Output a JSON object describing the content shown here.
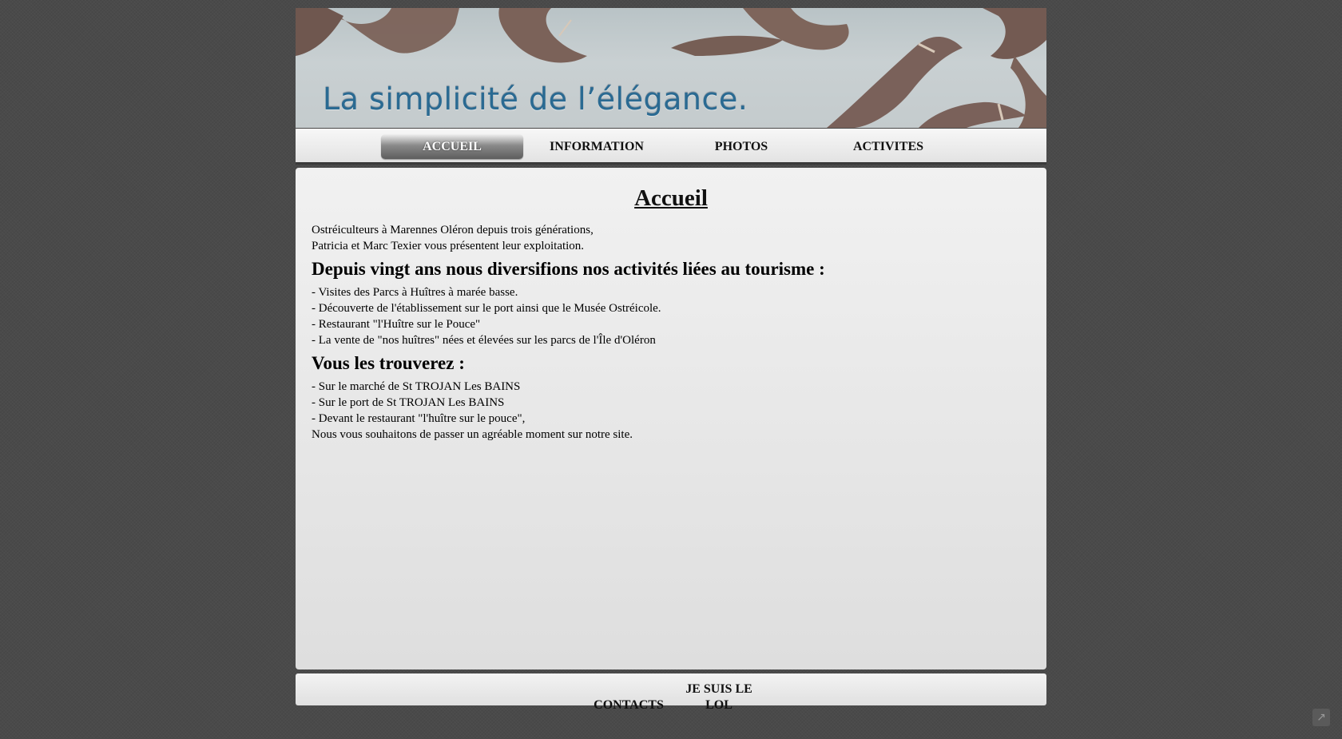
{
  "banner": {
    "slogan": "La simplicité de l’élégance."
  },
  "nav": {
    "items": [
      {
        "label": "ACCUEIL",
        "active": true
      },
      {
        "label": "INFORMATION",
        "active": false
      },
      {
        "label": "PHOTOS",
        "active": false
      },
      {
        "label": "ACTIVITES",
        "active": false
      }
    ]
  },
  "main": {
    "title": "Accueil",
    "intro": [
      "Ostréiculteurs à Marennes Oléron depuis trois générations,",
      "Patricia et Marc Texier vous présentent leur exploitation."
    ],
    "section1": {
      "heading": "Depuis vingt ans nous diversifions nos activités liées au tourisme :",
      "items": [
        "- Visites des Parcs à Huîtres à marée basse.",
        "- Découverte de l'établissement sur le port ainsi que le Musée Ostréicole.",
        "- Restaurant \"l'Huître sur le Pouce\"",
        "- La vente de \"nos huîtres\" nées et élevées sur les parcs de l'Île d'Oléron"
      ]
    },
    "section2": {
      "heading": "Vous les trouverez :",
      "items": [
        "- Sur le marché de St TROJAN Les BAINS",
        "- Sur le port de St TROJAN Les BAINS",
        "- Devant le restaurant \"l'huître sur le pouce\",",
        "Nous vous souhaitons de passer un agréable moment sur notre site."
      ]
    }
  },
  "footer": {
    "contacts": "CONTACTS",
    "je_suis_le_line1": "JE SUIS LE",
    "je_suis_le_line2": "LOL"
  },
  "colors": {
    "background": "#4a4a4a",
    "slogan": "#2a6a92",
    "active_nav": "#6a6a6a",
    "wood": "#7a635a"
  },
  "icons": {
    "share": "share-icon"
  }
}
